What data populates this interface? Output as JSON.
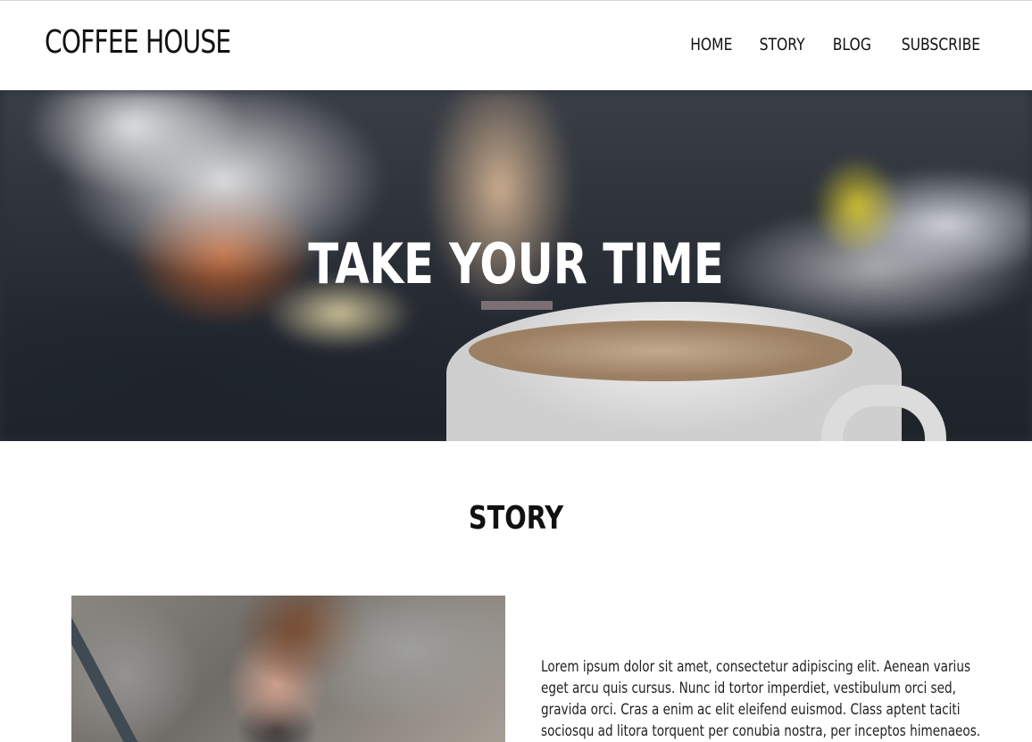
{
  "header": {
    "brand": "COFFEE HOUSE",
    "nav": [
      "HOME",
      "STORY",
      "BLOG",
      "SUBSCRIBE"
    ]
  },
  "hero": {
    "title": "TAKE YOUR TIME",
    "accent_color": "#7c6f73"
  },
  "story": {
    "heading": "STORY",
    "paragraph_lines": [
      "Lorem ipsum dolor sit amet, consectetur adipiscing elit. Aenean varius",
      "eget arcu quis cursus. Nunc id tortor imperdiet, vestibulum orci sed,",
      "gravida orci. Cras a enim ac elit eleifend euismod. Class aptent taciti",
      "sociosqu ad litora torquent per conubia nostra, per inceptos himenaeos."
    ]
  }
}
